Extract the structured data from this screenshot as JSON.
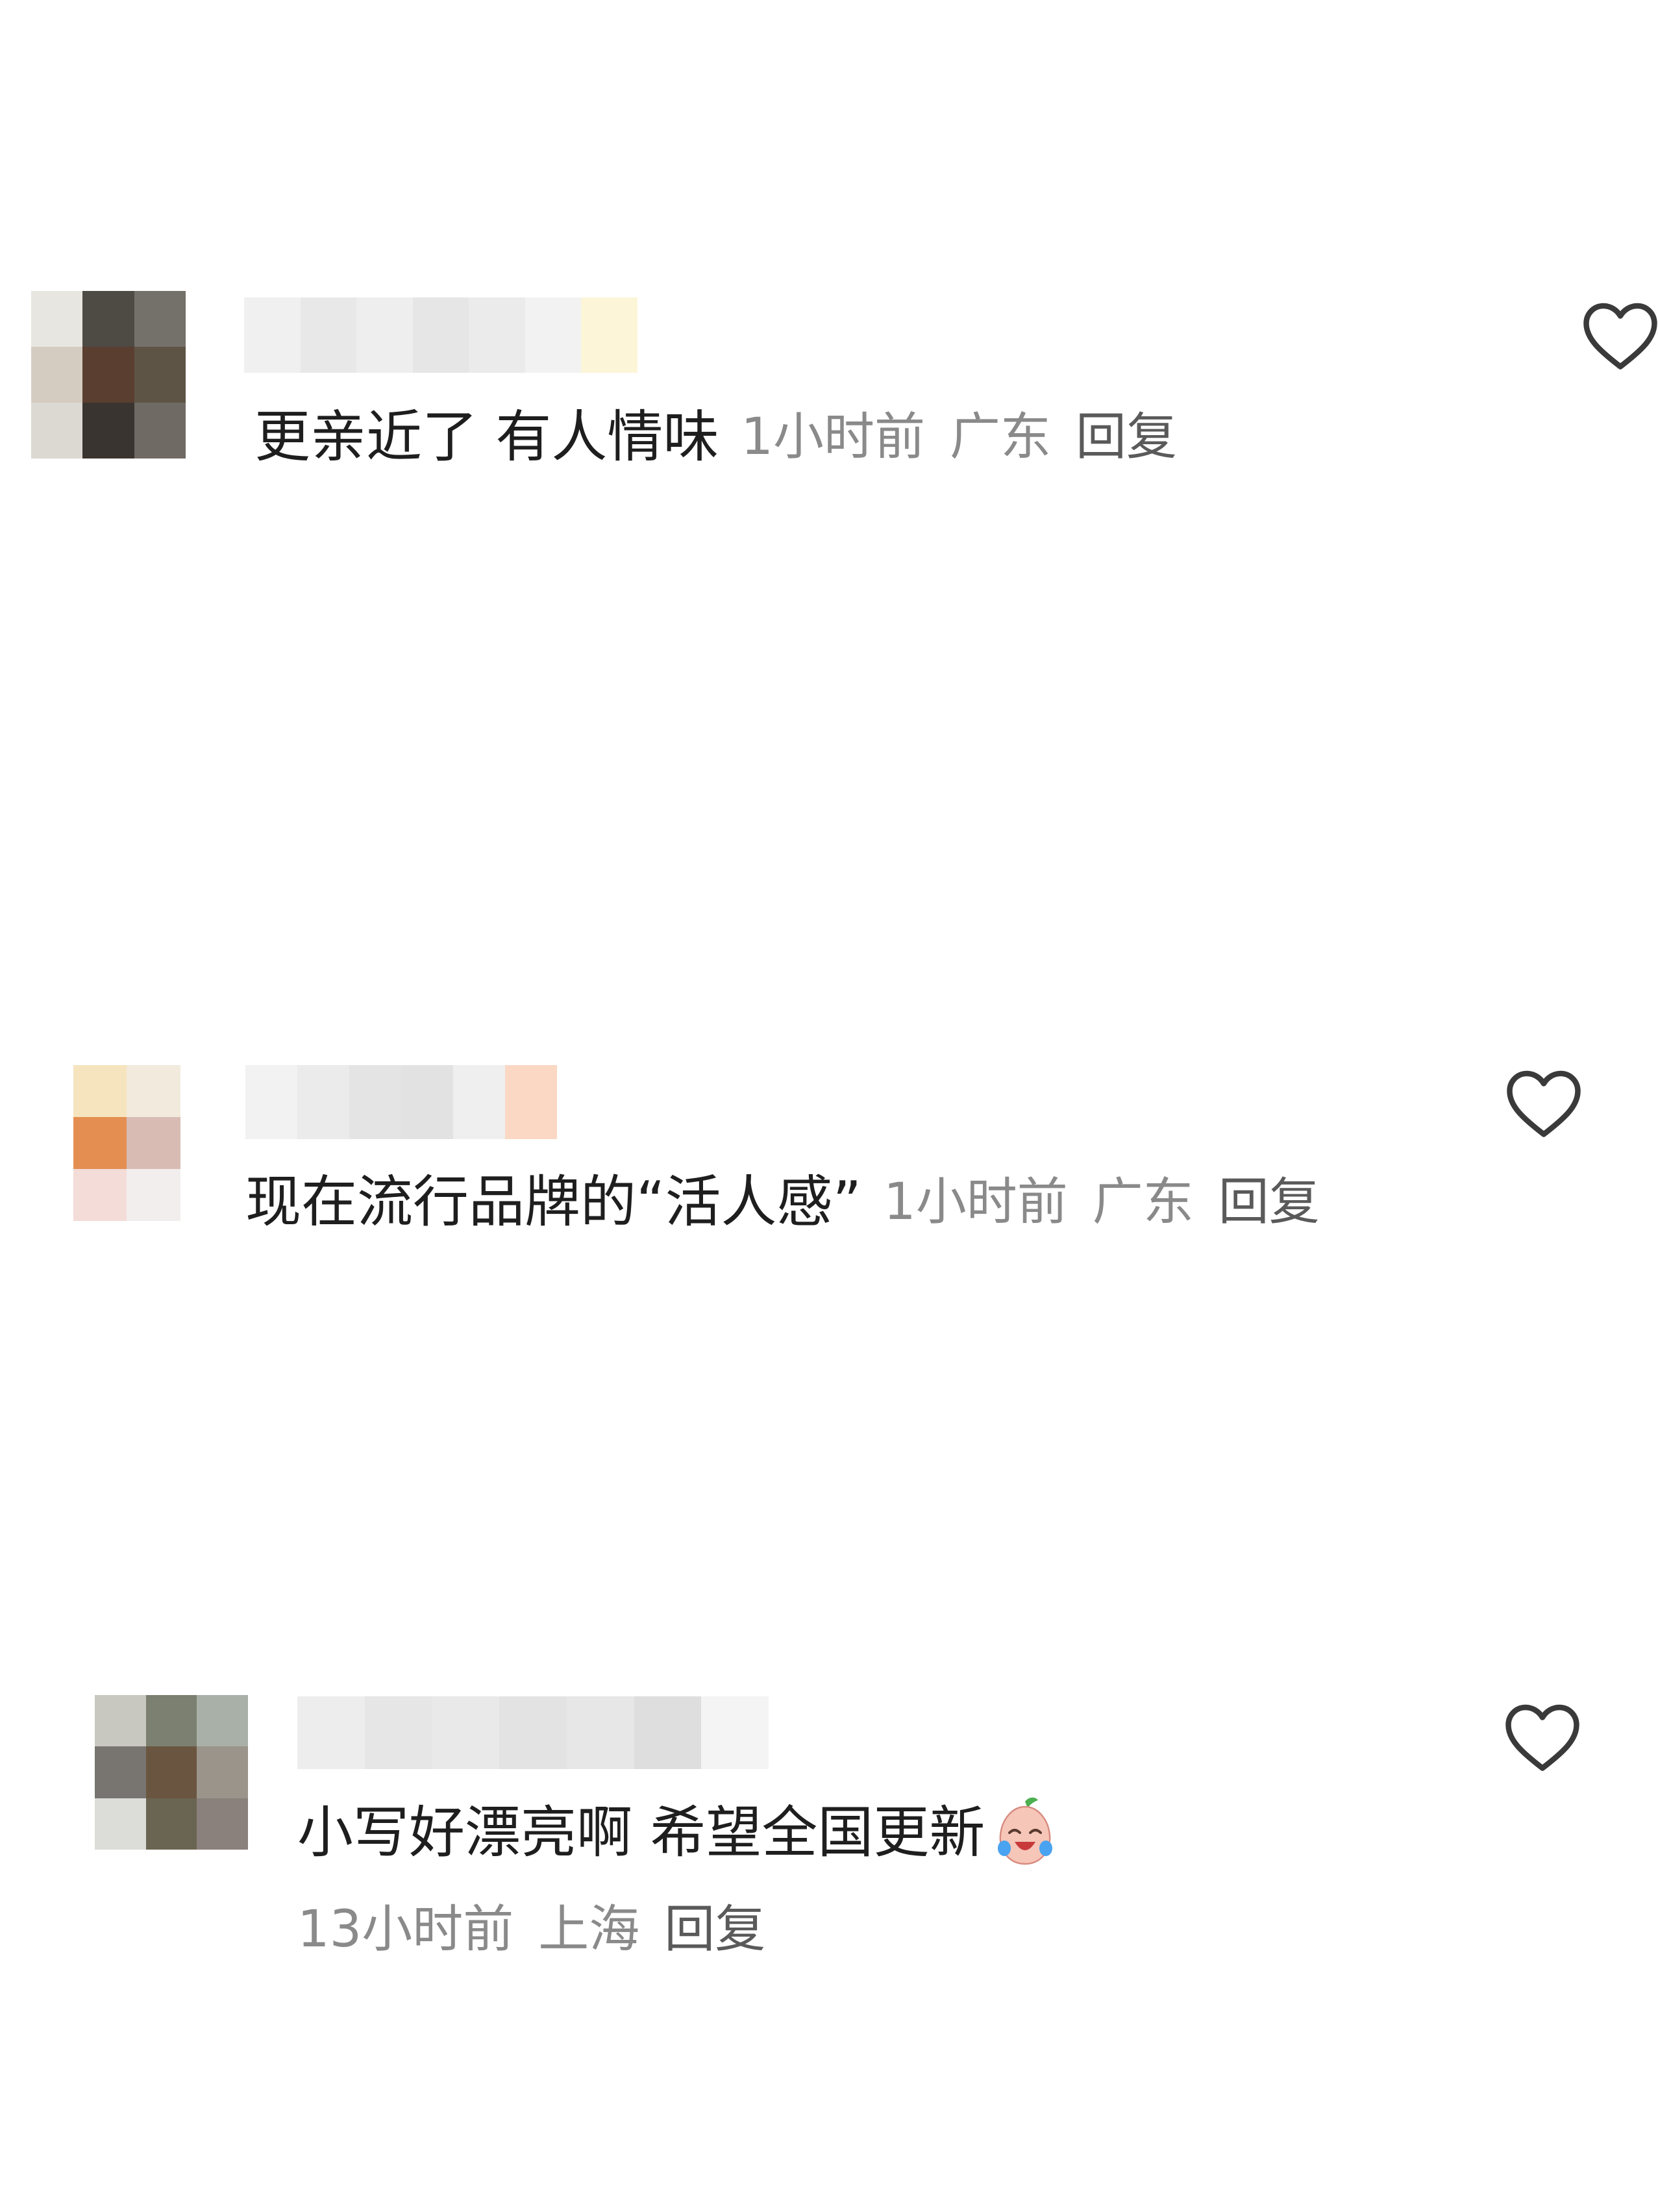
{
  "comments": [
    {
      "avatar_colors": [
        "#e8e6e0",
        "#4e4a44",
        "#74706a",
        "#d4ccc0",
        "#5a3e30",
        "#5e5446",
        "#dcd8d2",
        "#3a3430",
        "#706a64"
      ],
      "name_blur_colors": [
        "#f0f0f0",
        "#e8e8e8",
        "#eeeeee",
        "#e6e6e6",
        "#ebebeb",
        "#f2f2f2",
        "#fcf5d8"
      ],
      "text": "更亲近了 有人情味",
      "time": "1小时前",
      "location": "广东",
      "reply_label": "回复"
    },
    {
      "avatar_colors": [
        "#ffffff",
        "#f5e4be",
        "#f2eadc",
        "#ffffff",
        "#e48e52",
        "#d8bcb4",
        "#ffffff",
        "#f4dcd8",
        "#f2eeee"
      ],
      "name_blur_colors": [
        "#f2f2f2",
        "#ebebeb",
        "#e4e4e4",
        "#e2e2e2",
        "#efefef",
        "#fad8c4"
      ],
      "text": "现在流行品牌的“活人感”",
      "time": "1小时前",
      "location": "广东",
      "reply_label": "回复"
    },
    {
      "avatar_colors": [
        "#c8c8c0",
        "#7c8070",
        "#a8b0a8",
        "#787470",
        "#6a5640",
        "#9a948a",
        "#dcdcd8",
        "#6a6452",
        "#8a807c"
      ],
      "name_blur_colors": [
        "#ededed",
        "#e6e6e6",
        "#e9e9e9",
        "#e3e3e3",
        "#e7e7e7",
        "#dedede",
        "#f4f4f4"
      ],
      "text": "小写好漂亮啊 希望全国更新",
      "emoji": "crying-laughing-emoji",
      "time": "13小时前",
      "location": "上海",
      "reply_label": "回复"
    }
  ],
  "icons": {
    "like": "heart-outline-icon"
  },
  "colors": {
    "comment_text": "#1e1e1e",
    "meta_text": "#8a8a8a",
    "reply_text": "#5a5a5a",
    "heart_stroke": "#3a3a3a"
  }
}
